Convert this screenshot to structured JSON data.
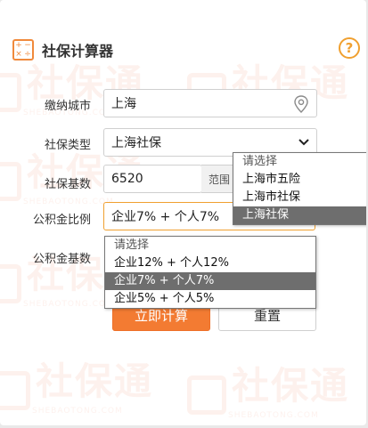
{
  "header": {
    "title": "社保计算器",
    "calc_icon_glyphs": [
      "+",
      "−",
      "×",
      "÷"
    ],
    "help_glyph": "?"
  },
  "watermark": {
    "text": "社保通",
    "sub": "SHEBAOTONG.COM"
  },
  "form": {
    "city": {
      "label": "缴纳城市",
      "value": "上海"
    },
    "type": {
      "label": "社保类型",
      "value": "上海社保"
    },
    "base": {
      "label": "社保基数",
      "value": "6520",
      "addon": "范围"
    },
    "fund_ratio": {
      "label": "公积金比例",
      "value": "企业7% + 个人7%"
    },
    "fund_base": {
      "label": "公积金基数"
    }
  },
  "type_dropdown": {
    "options": [
      {
        "label": "请选择",
        "state": "placeholder"
      },
      {
        "label": "上海市五险",
        "state": "normal"
      },
      {
        "label": "上海市社保",
        "state": "normal"
      },
      {
        "label": "上海社保",
        "state": "selected"
      }
    ]
  },
  "ratio_dropdown": {
    "options": [
      {
        "label": "请选择",
        "state": "placeholder"
      },
      {
        "label": "企业12% + 个人12%",
        "state": "normal"
      },
      {
        "label": "企业7% + 个人7%",
        "state": "selected"
      },
      {
        "label": "企业5% + 个人5%",
        "state": "normal"
      }
    ]
  },
  "buttons": {
    "calculate": "立即计算",
    "reset": "重置"
  },
  "colors": {
    "accent": "#f37b32",
    "highlight": "#6e6e6e",
    "help": "#f0a030"
  }
}
